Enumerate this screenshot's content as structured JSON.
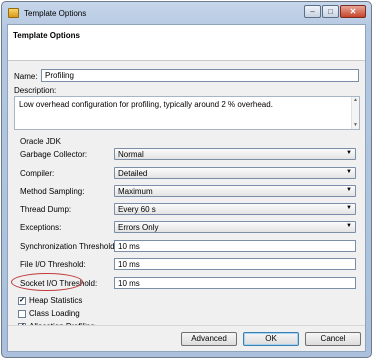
{
  "window": {
    "title": "Template Options"
  },
  "header": {
    "title": "Template Options"
  },
  "name": {
    "label": "Name:",
    "value": "Profiling"
  },
  "description": {
    "label": "Description:",
    "value": "Low overhead configuration for profiling, typically around 2 % overhead."
  },
  "section": {
    "label": "Oracle JDK"
  },
  "selects": [
    {
      "label": "Garbage Collector:",
      "value": "Normal"
    },
    {
      "label": "Compiler:",
      "value": "Detailed"
    },
    {
      "label": "Method Sampling:",
      "value": "Maximum"
    },
    {
      "label": "Thread Dump:",
      "value": "Every 60 s"
    },
    {
      "label": "Exceptions:",
      "value": "Errors Only"
    }
  ],
  "thresholds": [
    {
      "label": "Synchronization Threshold:",
      "value": "10 ms"
    },
    {
      "label": "File I/O Threshold:",
      "value": "10 ms"
    },
    {
      "label": "Socket I/O Threshold:",
      "value": "10 ms"
    }
  ],
  "checks": [
    {
      "label": "Heap Statistics",
      "checked": true
    },
    {
      "label": "Class Loading",
      "checked": false
    },
    {
      "label": "Allocation Profiling",
      "checked": true
    }
  ],
  "buttons": {
    "advanced": "Advanced",
    "ok": "OK",
    "cancel": "Cancel"
  },
  "colors": {
    "highlight": "#c23a3a",
    "title_bar": "#b3c7e0"
  }
}
